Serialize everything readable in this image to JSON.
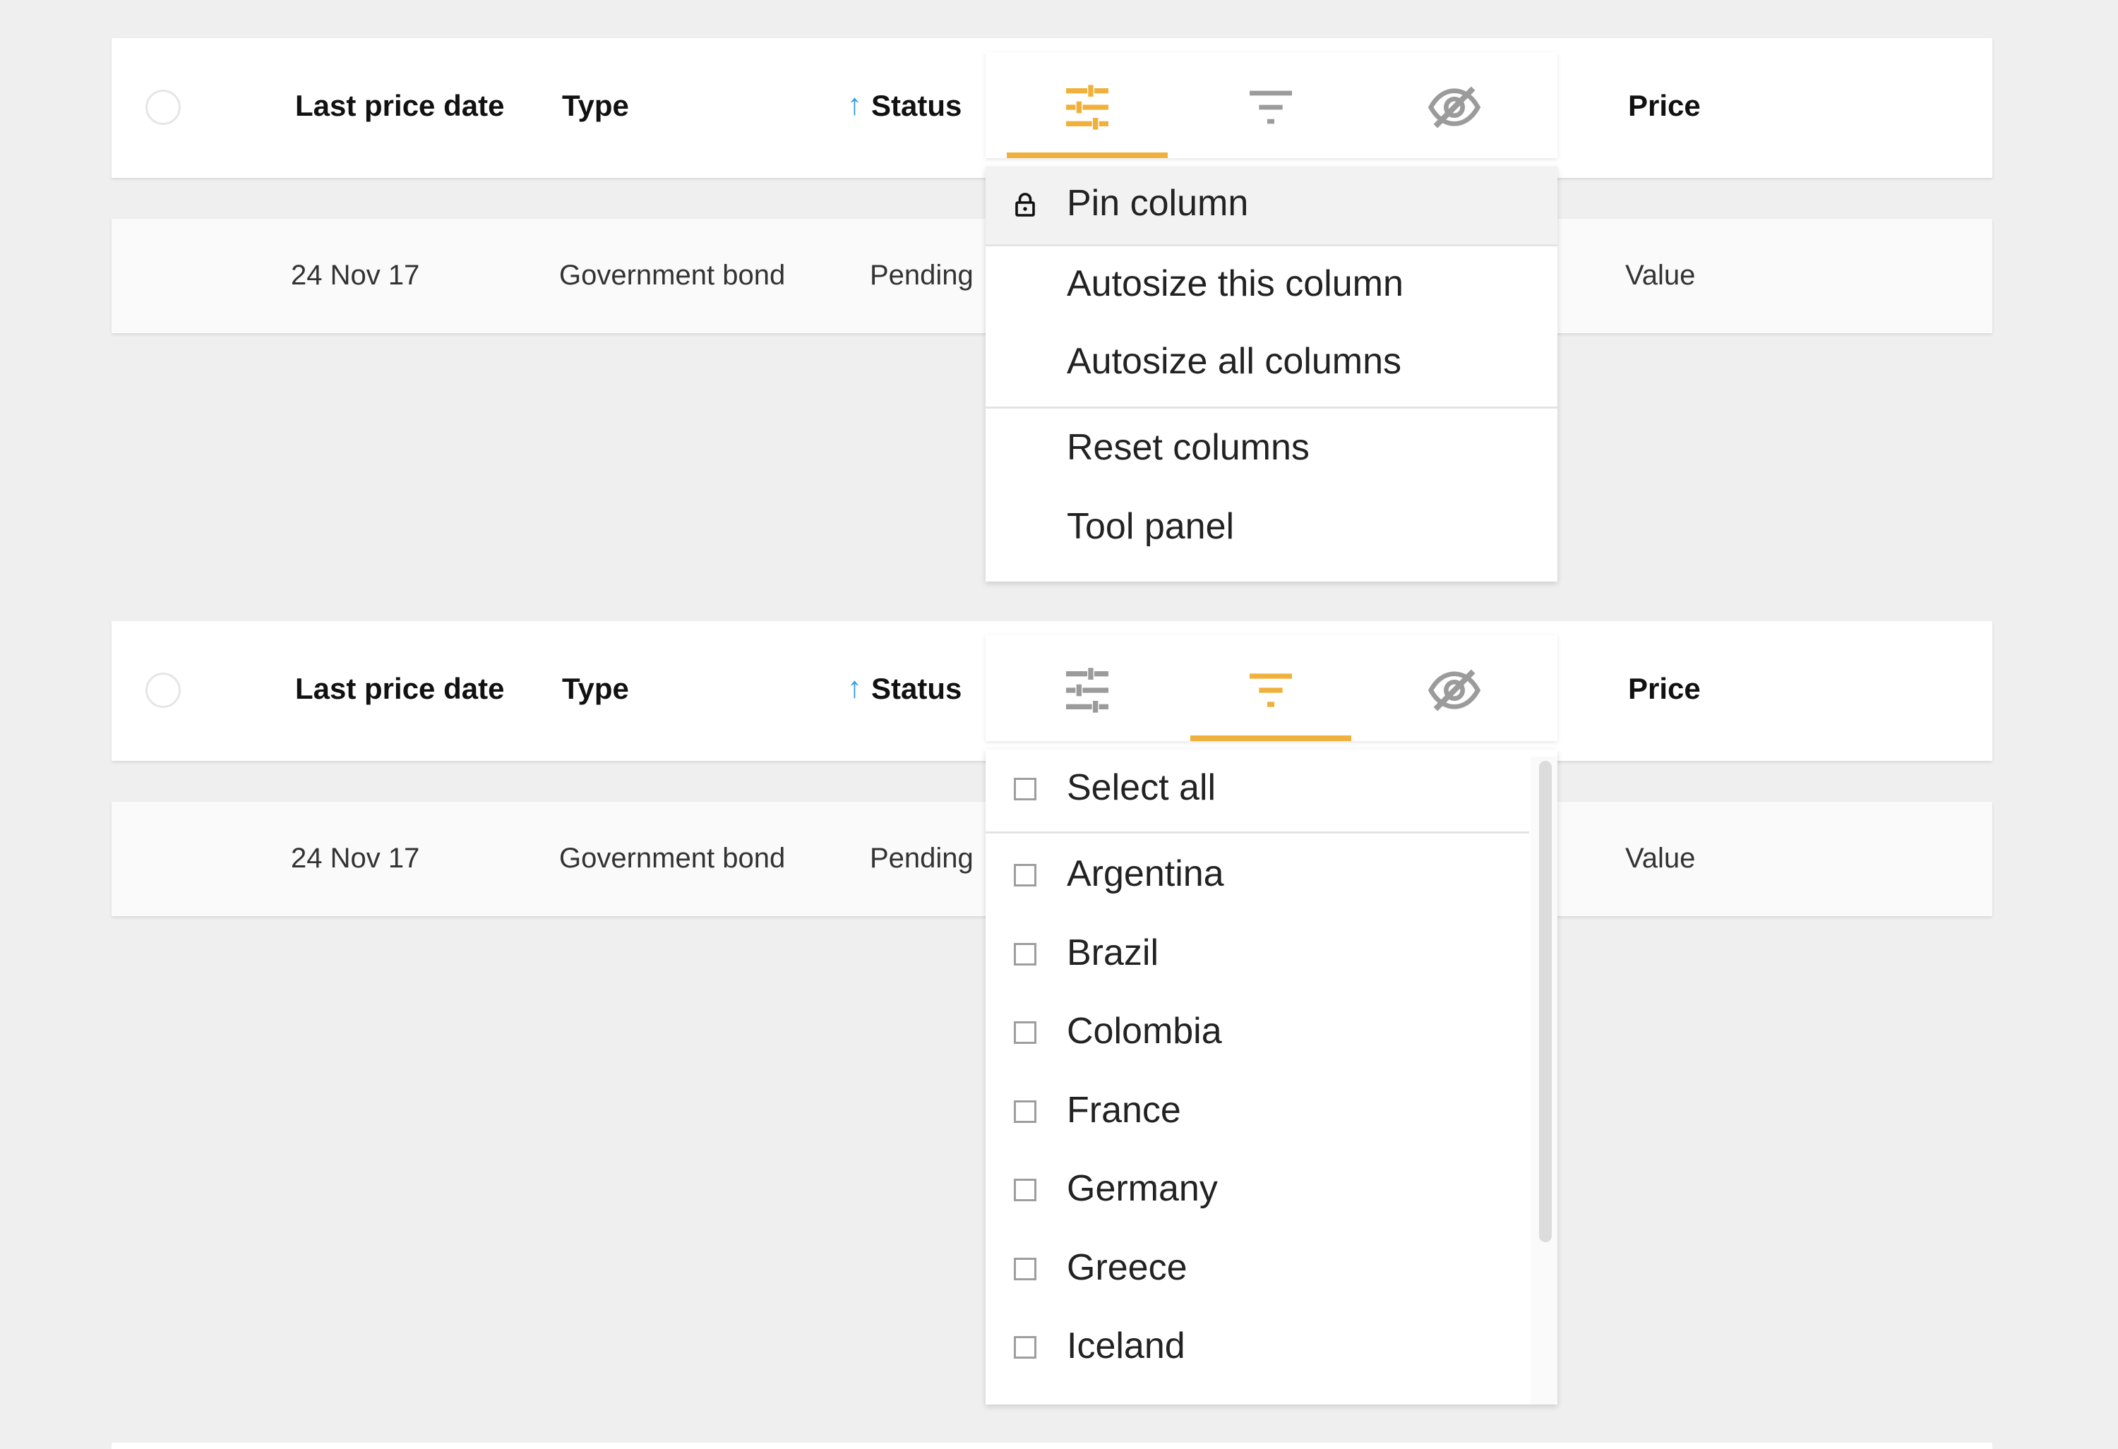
{
  "colors": {
    "accent": "#f0b13c",
    "sort_arrow": "#2e9ae6",
    "inactive_icon": "#9b9b9b"
  },
  "grid_top": {
    "header": {
      "col_date": "Last price date",
      "col_type": "Type",
      "sort_arrow": "↑",
      "col_status": "Status",
      "col_price": "Price"
    },
    "row": {
      "date": "24 Nov 17",
      "type": "Government bond",
      "status": "Pending",
      "price": "Value"
    },
    "menu_tabs": [
      {
        "icon": "sliders-icon",
        "active": true
      },
      {
        "icon": "filter-icon",
        "active": false
      },
      {
        "icon": "eye-off-icon",
        "active": false
      }
    ],
    "column_menu": {
      "pin_icon": "lock-icon",
      "pin_label": "Pin column",
      "pin_arrow": "›",
      "autosize_this": "Autosize this column",
      "autosize_all": "Autosize all columns",
      "reset": "Reset columns",
      "tool_panel": "Tool panel"
    }
  },
  "grid_bottom": {
    "header": {
      "col_date": "Last price date",
      "col_type": "Type",
      "sort_arrow": "↑",
      "col_status": "Status",
      "col_price": "Price"
    },
    "row": {
      "date": "24 Nov 17",
      "type": "Government bond",
      "status": "Pending",
      "price": "Value"
    },
    "menu_tabs": [
      {
        "icon": "sliders-icon",
        "active": false
      },
      {
        "icon": "filter-icon",
        "active": true
      },
      {
        "icon": "eye-off-icon",
        "active": false
      }
    ],
    "filter": {
      "select_all": "Select all",
      "options": [
        "Argentina",
        "Brazil",
        "Colombia",
        "France",
        "Germany",
        "Greece",
        "Iceland"
      ]
    }
  }
}
